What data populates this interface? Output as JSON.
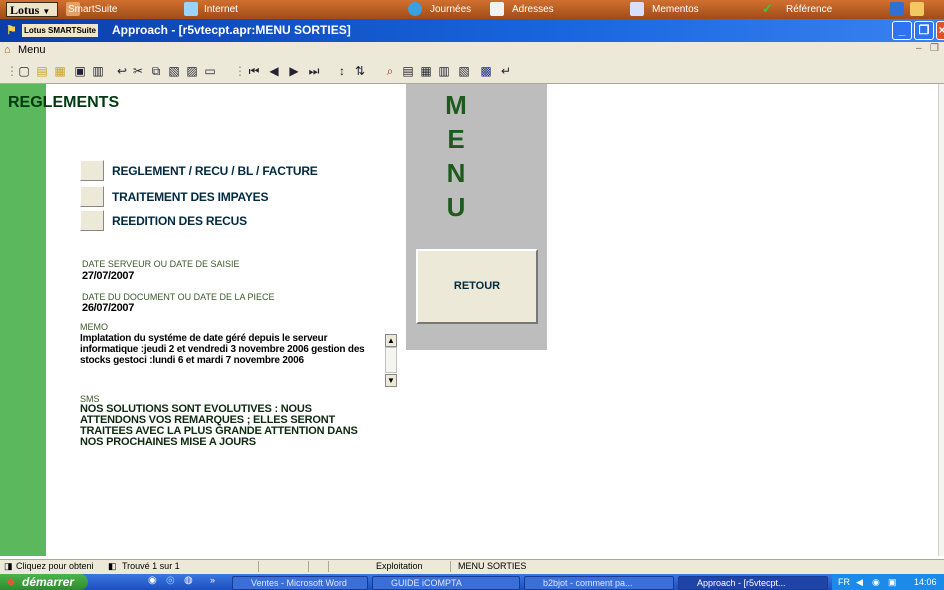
{
  "suitebar": {
    "lotus_label": "Lotus",
    "tabs": [
      "SmartSuite",
      "Internet",
      "Journées",
      "Adresses",
      "Mementos",
      "Référence"
    ]
  },
  "window": {
    "title": "Approach - [r5vtecpt.apr:MENU SORTIES]",
    "logo": "Lotus SMARTSuite"
  },
  "menubar": {
    "label": "Menu"
  },
  "content": {
    "heading": "REGLEMENTS",
    "options": [
      "REGLEMENT / RECU / BL / FACTURE",
      "TRAITEMENT DES  IMPAYES",
      "REEDITION DES RECUS"
    ],
    "date_serveur_label": "DATE SERVEUR OU DATE DE SAISIE",
    "date_serveur_value": "27/07/2007",
    "date_document_label": "DATE DU DOCUMENT OU DATE DE LA PIECE",
    "date_document_value": "26/07/2007",
    "memo_label": "MEMO",
    "memo_text": "Implatation du systéme de date géré depuis le serveur informatique :jeudi 2 et vendredi 3 novembre 2006 gestion des stocks gestoci :lundi  6 et mardi 7 novembre 2006",
    "sms_label": "SMS",
    "sms_text": "NOS SOLUTIONS SONT EVOLUTIVES : NOUS ATTENDONS VOS REMARQUES ; ELLES SERONT TRAITEES AVEC LA PLUS GRANDE ATTENTION DANS NOS PROCHAINES MISE A JOURS"
  },
  "menu_panel": {
    "letters": [
      "M",
      "E",
      "N",
      "U"
    ],
    "retour_label": "RETOUR"
  },
  "statusbar": {
    "hint": "Cliquez pour obteni",
    "found": "Trouvé 1 sur 1",
    "mode": "Exploitation",
    "form": "MENU SORTIES"
  },
  "taskbar": {
    "start_label": "démarrer",
    "tasks": [
      "Ventes - Microsoft Word",
      "GUIDE iCOMPTA",
      "b2bjot - comment pa...",
      "Approach - [r5vtecpt..."
    ],
    "lang": "FR",
    "clock": "14:06"
  },
  "colors": {
    "green_bar": "#5cb85c",
    "menu_panel": "#bdbdbd",
    "title_bar": "#1966e0",
    "suite_bar": "#b85a1e"
  }
}
